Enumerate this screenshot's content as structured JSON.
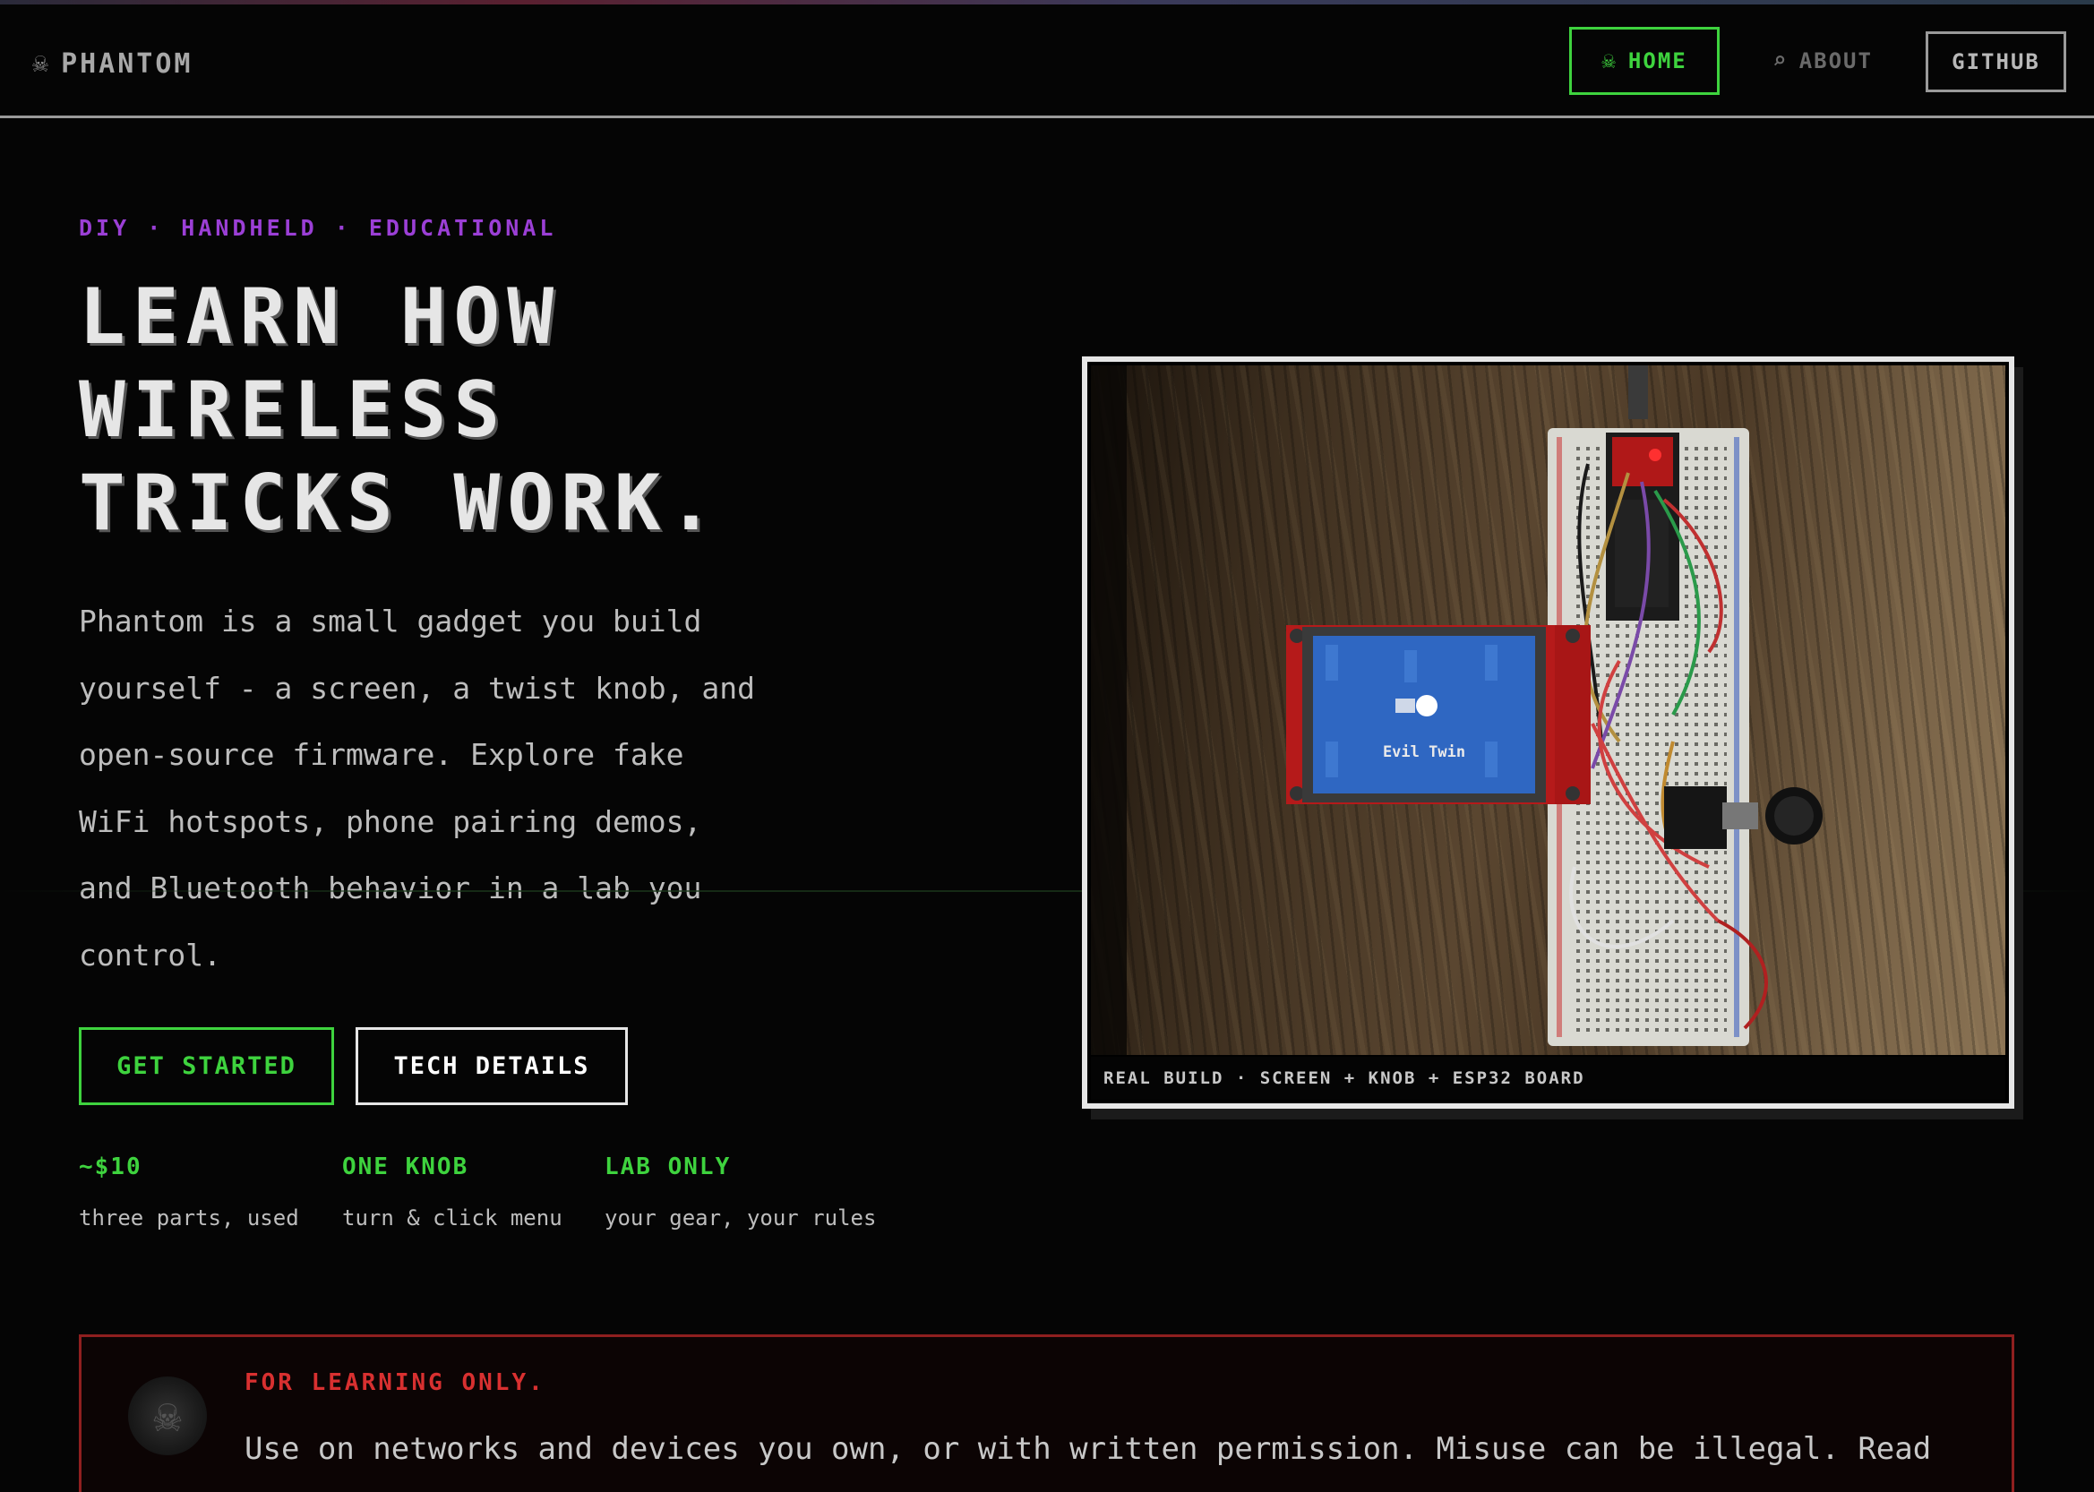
{
  "nav": {
    "brand_icon": "ghost-skull-icon",
    "brand_name": "PHANTOM",
    "home": {
      "label": "HOME",
      "icon": "reaper-icon"
    },
    "about": {
      "label": "ABOUT",
      "icon": "search-icon"
    },
    "github": {
      "label": "GITHUB"
    }
  },
  "hero": {
    "eyebrow": "DIY · HANDHELD · EDUCATIONAL",
    "headline": [
      "LEARN HOW",
      "WIRELESS",
      "TRICKS WORK."
    ],
    "lead": "Phantom is a small gadget you build yourself - a screen, a twist knob, and open-source firmware. Explore fake WiFi hotspots, phone pairing demos, and Bluetooth behavior in a lab you control.",
    "cta_primary": "GET STARTED",
    "cta_secondary": "TECH DETAILS",
    "stats": [
      {
        "value": "~$10",
        "desc": "three parts, used"
      },
      {
        "value": "ONE KNOB",
        "desc": "turn & click menu"
      },
      {
        "value": "LAB ONLY",
        "desc": "your gear, your rules"
      }
    ]
  },
  "photo": {
    "screen_text": "Evil Twin",
    "caption": "REAL BUILD · SCREEN + KNOB + ESP32 BOARD"
  },
  "warning": {
    "title": "FOR LEARNING ONLY.",
    "text": "Use on networks and devices you own, or with written permission. Misuse can be illegal. Read the"
  },
  "colors": {
    "accent_green": "#3ed33e",
    "accent_purple": "#9b3fd6",
    "warning_red": "#d83030",
    "background": "#050505"
  }
}
